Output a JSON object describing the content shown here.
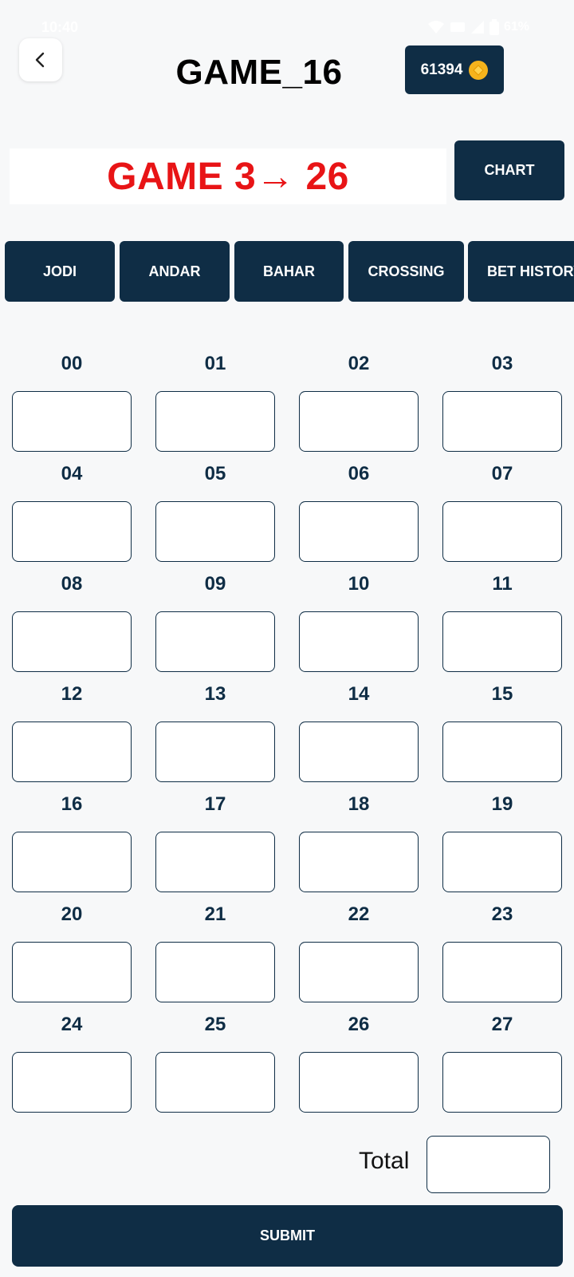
{
  "status_bar": {
    "time": "10:40",
    "battery": "61%"
  },
  "header": {
    "title": "GAME_16",
    "wallet_balance": "61394",
    "back_icon": "chevron-left-icon",
    "coin_icon": "coin-icon"
  },
  "banner": {
    "text": "GAME 3→ 26"
  },
  "chart_button": {
    "label": "CHART"
  },
  "tabs": [
    {
      "label": "JODI"
    },
    {
      "label": "ANDAR"
    },
    {
      "label": "BAHAR"
    },
    {
      "label": "CROSSING"
    },
    {
      "label": "BET HISTORY"
    }
  ],
  "numbers": [
    "00",
    "01",
    "02",
    "03",
    "04",
    "05",
    "06",
    "07",
    "08",
    "09",
    "10",
    "11",
    "12",
    "13",
    "14",
    "15",
    "16",
    "17",
    "18",
    "19",
    "20",
    "21",
    "22",
    "23",
    "24",
    "25",
    "26",
    "27"
  ],
  "total": {
    "label": "Total",
    "value": ""
  },
  "submit": {
    "label": "SUBMIT"
  },
  "colors": {
    "primary": "#0f2d45",
    "banner_text": "#e81416",
    "coin": "#f5b31c",
    "background": "#f7f8f9"
  }
}
